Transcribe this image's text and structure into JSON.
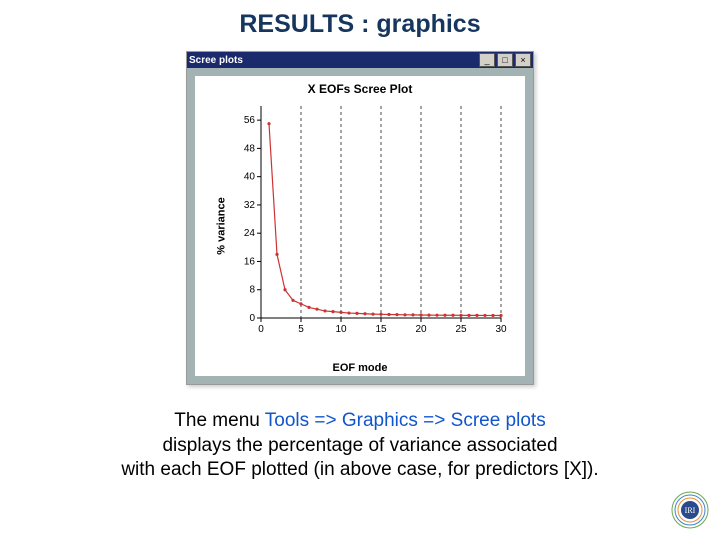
{
  "slide_title": "RESULTS : graphics",
  "window": {
    "title": "Scree plots",
    "min_label": "_",
    "max_label": "□",
    "close_label": "×"
  },
  "chart_data": {
    "type": "line",
    "title": "X EOFs Scree Plot",
    "xlabel": "EOF mode",
    "ylabel": "% variance",
    "x_ticks": [
      0,
      5,
      10,
      15,
      20,
      25,
      30
    ],
    "y_ticks": [
      0,
      8,
      16,
      24,
      32,
      40,
      48,
      56
    ],
    "xlim": [
      0,
      30
    ],
    "ylim": [
      0,
      60
    ],
    "x": [
      1,
      2,
      3,
      4,
      5,
      6,
      7,
      8,
      9,
      10,
      11,
      12,
      13,
      14,
      15,
      16,
      17,
      18,
      19,
      20,
      21,
      22,
      23,
      24,
      25,
      26,
      27,
      28,
      29,
      30
    ],
    "values": [
      55,
      18,
      8,
      5,
      4,
      3,
      2.5,
      2,
      1.8,
      1.6,
      1.4,
      1.3,
      1.2,
      1.1,
      1.05,
      1.0,
      0.95,
      0.9,
      0.88,
      0.85,
      0.82,
      0.8,
      0.78,
      0.77,
      0.76,
      0.75,
      0.74,
      0.73,
      0.72,
      0.71
    ],
    "series_color": "#cc3333",
    "grid_dashed_x": [
      5,
      10,
      15,
      20,
      25,
      30
    ]
  },
  "caption": {
    "pre": "The menu ",
    "link": "Tools => Graphics => Scree plots",
    "post1": "displays the percentage of variance associated",
    "post2": "with each EOF plotted (in above case, for predictors [X])."
  },
  "logo_text": "IRI"
}
